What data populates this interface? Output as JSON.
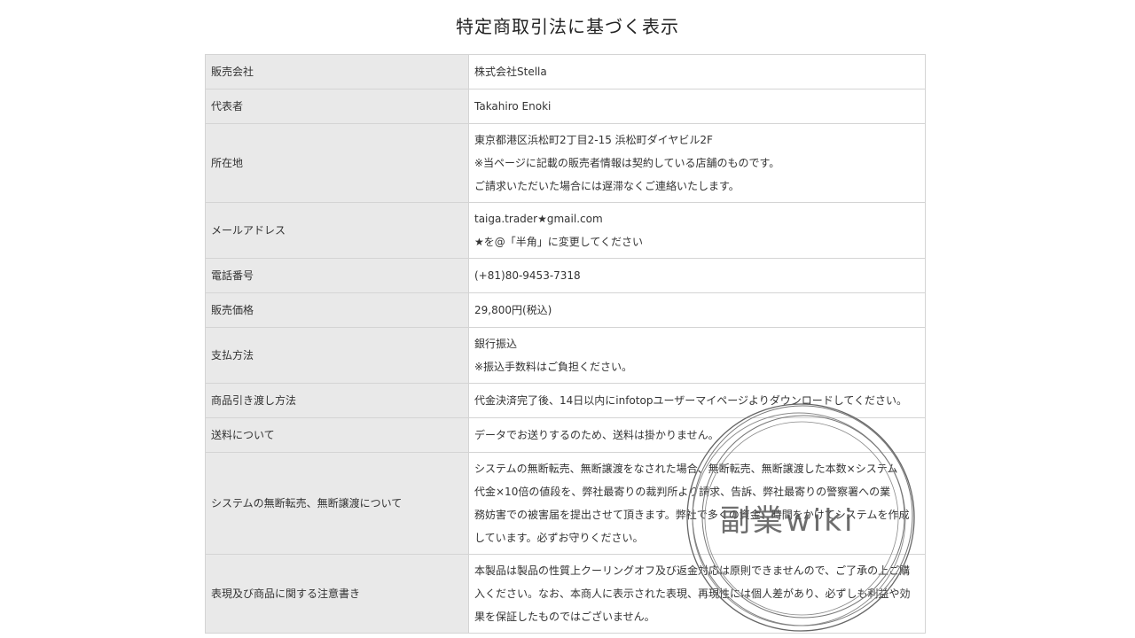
{
  "title": "特定商取引法に基づく表示",
  "rows": [
    {
      "label": "販売会社",
      "lines": [
        "株式会社Stella"
      ]
    },
    {
      "label": "代表者",
      "lines": [
        "Takahiro Enoki"
      ]
    },
    {
      "label": "所在地",
      "lines": [
        "東京都港区浜松町2丁目2-15 浜松町ダイヤビル2F",
        "※当ページに記載の販売者情報は契約している店舗のものです。",
        "ご請求いただいた場合には遅滞なくご連絡いたします。"
      ]
    },
    {
      "label": "メールアドレス",
      "lines": [
        "taiga.trader★gmail.com",
        "★を@「半角」に変更してください"
      ]
    },
    {
      "label": "電話番号",
      "lines": [
        "(+81)80-9453-7318"
      ]
    },
    {
      "label": "販売価格",
      "lines": [
        "29,800円(税込)"
      ]
    },
    {
      "label": "支払方法",
      "lines": [
        "銀行振込",
        "※振込手数料はご負担ください。"
      ]
    },
    {
      "label": "商品引き渡し方法",
      "lines": [
        "代金決済完了後、14日以内にinfotopユーザーマイページよりダウンロードしてください。"
      ]
    },
    {
      "label": "送料について",
      "lines": [
        "データでお送りするのため、送料は掛かりません。"
      ]
    },
    {
      "label": "システムの無断転売、無断譲渡について",
      "lines": [
        "システムの無断転売、無断譲渡をなされた場合、無断転売、無断譲渡した本数×システム",
        "代金×10倍の値段を、弊社最寄りの裁判所より請求、告訴、弊社最寄りの警察署への業",
        "務妨害での被害届を提出させて頂きます。弊社で多くの資金、時間をかけてシステムを作成",
        "しています。必ずお守りください。"
      ]
    },
    {
      "label": "表現及び商品に関する注意書き",
      "lines": [
        "本製品は製品の性質上クーリングオフ及び返金対応は原則できませんので、ご了承の上ご購",
        "入ください。なお、本商人に表示された表現、再現性には個人差があり、必ずしも利益や効",
        "果を保証したものではございません。"
      ]
    }
  ],
  "watermark": {
    "text": "副業wiki",
    "color": "#555555"
  }
}
